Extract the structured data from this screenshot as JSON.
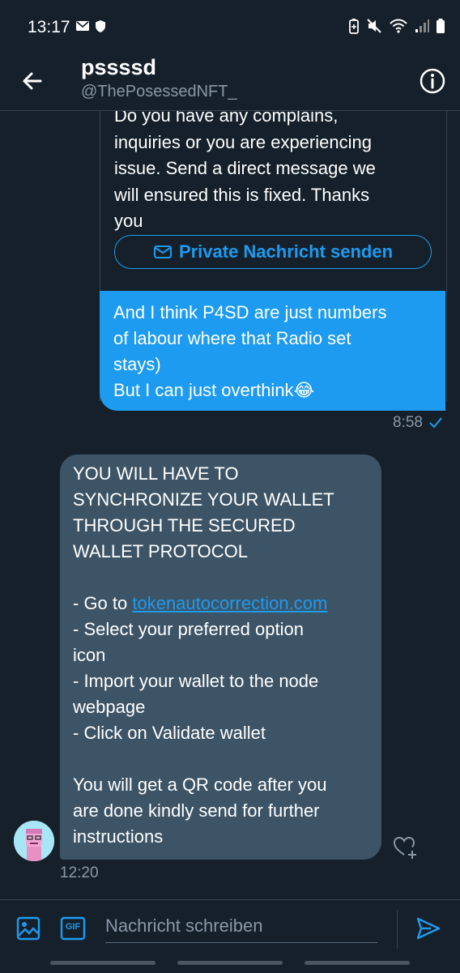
{
  "status_bar": {
    "time": "13:17"
  },
  "header": {
    "name": "pssssd",
    "handle": "@ThePosessedNFT_"
  },
  "quoted_card": {
    "lines": [
      "Do you have any complains,",
      "inquiries or you are experiencing",
      "issue. Send a direct message we",
      "will ensured this is fixed. Thanks",
      "you"
    ],
    "button_label": "Private Nachricht senden"
  },
  "sent_message": {
    "lines": [
      "And I think P4SD are just numbers",
      "of labour where that Radio set",
      "stays)",
      "But I can just overthink😂"
    ],
    "time": "8:58"
  },
  "received_message": {
    "lines": [
      "YOU WILL HAVE TO",
      "SYNCHRONIZE YOUR WALLET",
      "THROUGH THE SECURED",
      "WALLET PROTOCOL",
      "",
      "- Go to "
    ],
    "link_text": "tokenautocorrection.com",
    "lines_after": [
      "- Select your preferred option",
      "icon",
      "- Import your wallet to the node",
      "webpage",
      "- Click on Validate wallet",
      "",
      "You will get a QR code after you",
      "are done kindly send for further",
      "instructions"
    ],
    "time": "12:20"
  },
  "composer": {
    "placeholder": "Nachricht schreiben",
    "gif_label": "GIF"
  },
  "colors": {
    "background": "#15202b",
    "accent": "#1d9bf0",
    "received_bubble": "#3d5466",
    "muted": "#8b98a5"
  },
  "icons": {
    "back": "arrow-left-icon",
    "info": "info-icon",
    "mail": "mail-icon",
    "check": "check-icon",
    "react": "heart-plus-icon",
    "media": "image-icon",
    "gif": "gif-icon",
    "send": "send-icon"
  }
}
